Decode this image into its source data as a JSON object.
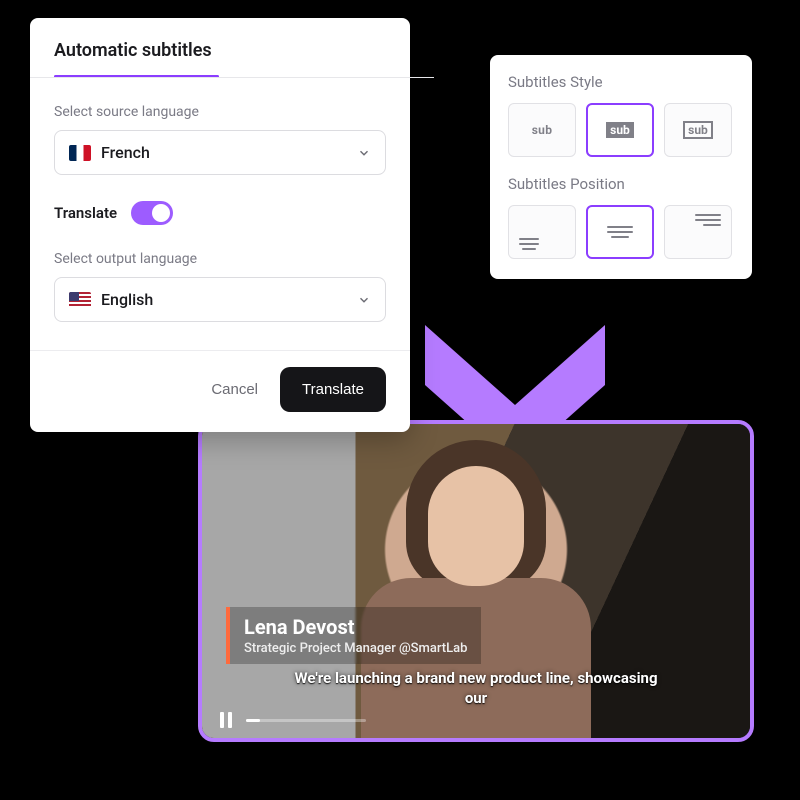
{
  "modal": {
    "title": "Automatic subtitles",
    "source_label": "Select source language",
    "source_value": "French",
    "translate_label": "Translate",
    "output_label": "Select output language",
    "output_value": "English",
    "cancel": "Cancel",
    "confirm": "Translate"
  },
  "style_panel": {
    "style_label": "Subtitles Style",
    "position_label": "Subtitles Position",
    "glyph": "sub"
  },
  "video": {
    "name": "Lena Devost",
    "role": "Strategic Project Manager @SmartLab",
    "caption": "We're launching a brand new product line, showcasing our"
  }
}
